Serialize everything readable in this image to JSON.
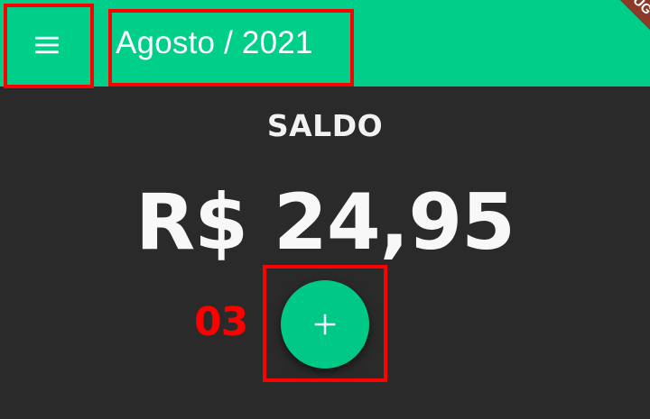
{
  "app_bar": {
    "title": "Agosto / 2021",
    "background_color": "#00cf8a",
    "menu_icon": "hamburger-menu-icon",
    "debug_banner": "DEBUG"
  },
  "balance": {
    "label": "SALDO",
    "value": "R$ 24,95"
  },
  "fab": {
    "icon": "plus-icon",
    "color": "#00c887"
  },
  "annotations": {
    "step_number": "03",
    "highlight_color": "#ff0000"
  },
  "colors": {
    "background": "#2a2a2a",
    "text": "#ffffff"
  }
}
